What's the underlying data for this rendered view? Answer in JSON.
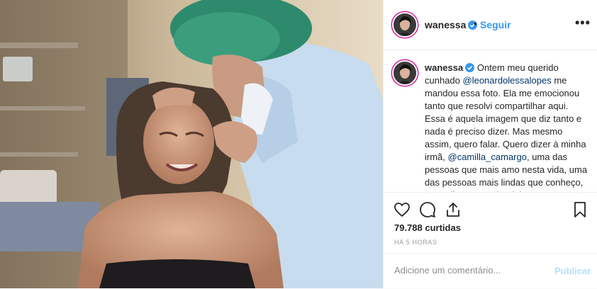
{
  "header": {
    "username": "wanessa",
    "separator": "•",
    "follow_label": "Seguir",
    "more_icon": "more-options-icon"
  },
  "caption": {
    "username": "wanessa",
    "text_1": "Ontem meu querido cunhado ",
    "mention_1": "@leonardolessalopes",
    "text_2": " me mandou essa foto. Ela me emocionou tanto que resolvi compartilhar aqui. Essa é aquela imagem que diz tanto e nada é preciso dizer. Mas mesmo assim, quero falar. Quero dizer à minha irmã, ",
    "mention_2": "@camilla_camargo",
    "text_3": ", uma das pessoas que mais amo nesta vida, uma das pessoas mais lindas que conheço, o orgulho que tenho dela. Nesta mesma imagem da foto, da irmã..."
  },
  "actions": {
    "icons": [
      "heart-icon",
      "comment-icon",
      "share-icon",
      "bookmark-icon"
    ]
  },
  "likes": "79.788 curtidas",
  "timestamp": "HÁ 5 HORAS",
  "comment_box": {
    "placeholder": "Adicione um comentário...",
    "publish_label": "Publicar"
  },
  "colors": {
    "link": "#3897f0",
    "mention": "#003569",
    "publish_disabled": "#b2dffc",
    "story_ring": "#d6249f",
    "verified": "#3897f0"
  }
}
